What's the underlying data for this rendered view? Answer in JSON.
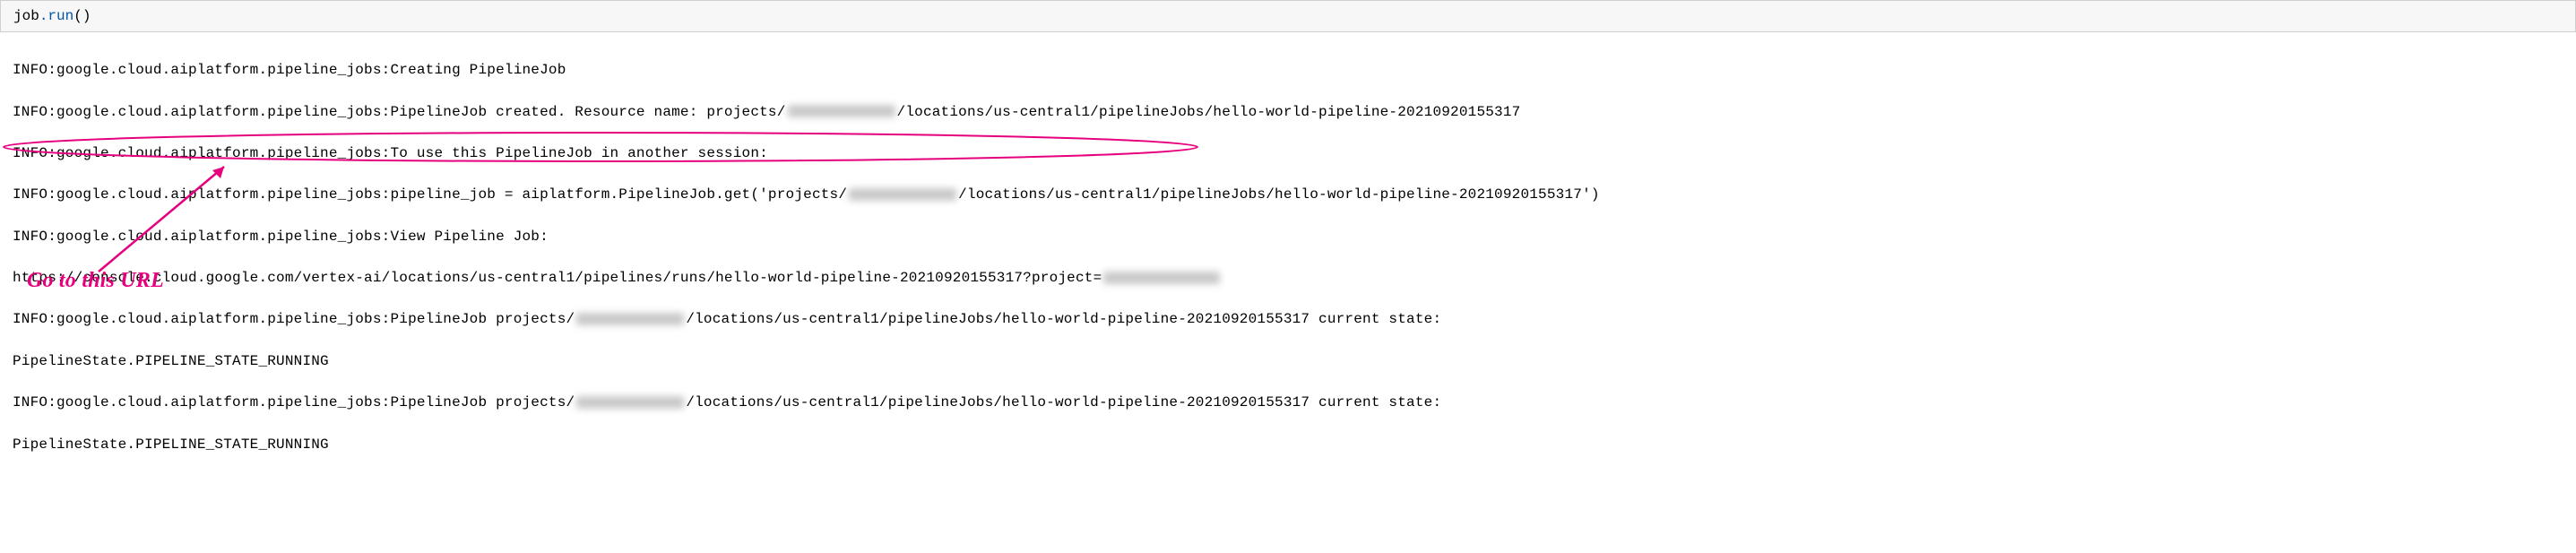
{
  "codeCell": {
    "obj": "job",
    "method": ".run",
    "parens": "()"
  },
  "output": {
    "prefix": "INFO:google.cloud.aiplatform.pipeline_jobs:",
    "line1_suffix": "Creating PipelineJob",
    "line2_part1": "PipelineJob created. Resource name: projects/",
    "line2_part2": "/locations/us-central1/pipelineJobs/hello-world-pipeline-20210920155317",
    "line3_suffix": "To use this PipelineJob in another session:",
    "line4_part1": "pipeline_job = aiplatform.PipelineJob.get('projects/",
    "line4_part2": "/locations/us-central1/pipelineJobs/hello-world-pipeline-20210920155317')",
    "line5_suffix": "View Pipeline Job:",
    "url_part1": "https://console.cloud.google.com/vertex-ai/locations/us-central1/pipelines/runs/hello-world-pipeline-20210920155317?project=",
    "line7_part1": "PipelineJob projects/",
    "line7_part2": "/locations/us-central1/pipelineJobs/hello-world-pipeline-20210920155317 current state:",
    "state_line": "PipelineState.PIPELINE_STATE_RUNNING",
    "line9_part1": "PipelineJob projects/",
    "line9_part2": "/locations/us-central1/pipelineJobs/hello-world-pipeline-20210920155317 current state:"
  },
  "annotation": {
    "label": "Go to this URL",
    "circle_color": "#e6007e"
  }
}
